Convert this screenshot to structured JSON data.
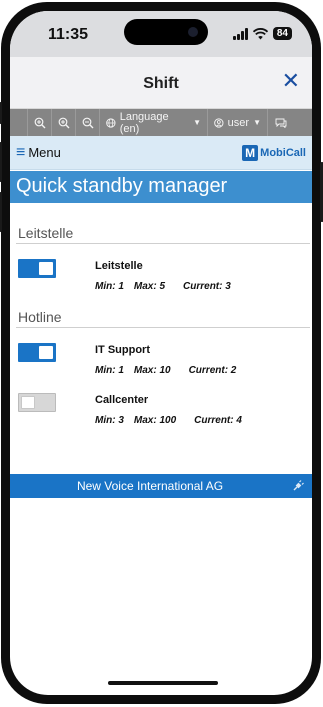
{
  "status_bar": {
    "time": "11:35",
    "battery": "84"
  },
  "header": {
    "title": "Shift",
    "close_symbol": "✕"
  },
  "toolbar": {
    "zoom_reset_icon": "zoom-reset-icon",
    "zoom_in_icon": "zoom-in-icon",
    "zoom_out_icon": "zoom-out-icon",
    "language_label": "Language (en)",
    "user_label": "user"
  },
  "menu": {
    "label": "Menu",
    "logo_letter": "M",
    "logo_text": "MobiCall"
  },
  "page": {
    "title": "Quick standby manager"
  },
  "sections": [
    {
      "heading": "Leitstelle",
      "groups": [
        {
          "name": "Leitstelle",
          "min": "Min: 1",
          "max": "Max: 5",
          "current": "Current: 3",
          "enabled": true
        }
      ]
    },
    {
      "heading": "Hotline",
      "groups": [
        {
          "name": "IT Support",
          "min": "Min: 1",
          "max": "Max: 10",
          "current": "Current: 2",
          "enabled": true
        },
        {
          "name": "Callcenter",
          "min": "Min: 3",
          "max": "Max: 100",
          "current": "Current: 4",
          "enabled": false
        }
      ]
    }
  ],
  "footer": {
    "company": "New Voice International AG"
  },
  "colors": {
    "accent": "#1a74c6",
    "title_bar": "#3d8fcf",
    "menu_bar": "#daeaf6",
    "toolbar": "#858585"
  }
}
